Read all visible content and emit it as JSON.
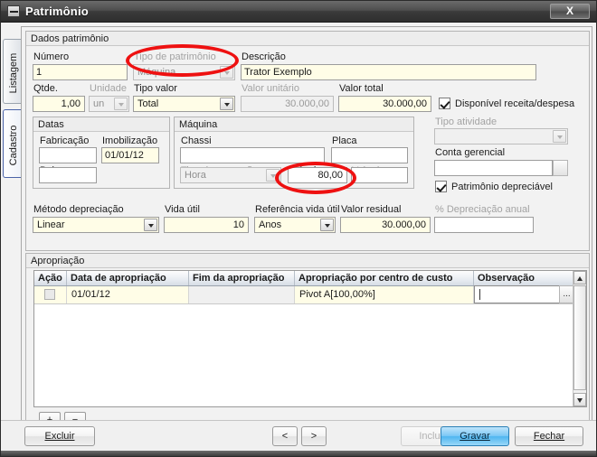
{
  "window": {
    "title": "Patrimônio",
    "close_label": "X",
    "icon": "minimize-box-icon"
  },
  "sidebar": {
    "tabs": [
      {
        "label": "Listagem",
        "selected": false
      },
      {
        "label": "Cadastro",
        "selected": true
      }
    ]
  },
  "groups": {
    "dados": "Dados patrimônio",
    "datas": "Datas",
    "maquina": "Máquina",
    "apropriacao": "Apropriação"
  },
  "form": {
    "numero": {
      "label": "Número",
      "value": "1"
    },
    "tipo_patrimonio": {
      "label": "Tipo de patrimônio",
      "value": "Máquina"
    },
    "descricao": {
      "label": "Descrição",
      "value": "Trator Exemplo"
    },
    "qtde": {
      "label": "Qtde.",
      "value": "1,00"
    },
    "unidade": {
      "label": "Unidade",
      "value": "un"
    },
    "tipo_valor": {
      "label": "Tipo valor",
      "value": "Total"
    },
    "valor_unitario": {
      "label": "Valor unitário",
      "value": "30.000,00"
    },
    "valor_total": {
      "label": "Valor total",
      "value": "30.000,00"
    },
    "disponivel_receita": {
      "label": "Disponível receita/despesa",
      "checked": true
    },
    "tipo_atividade": {
      "label": "Tipo atividade",
      "value": ""
    },
    "conta_gerencial": {
      "label": "Conta gerencial",
      "value": ""
    },
    "patrimonio_depreciavel": {
      "label": "Patrimônio depreciável",
      "checked": true
    },
    "fabricacao": {
      "label": "Fabricação",
      "value": ""
    },
    "imobilizacao": {
      "label": "Imobilização",
      "value": "01/01/12"
    },
    "baixa": {
      "label": "Baixa",
      "value": ""
    },
    "chassi": {
      "label": "Chassi",
      "value": ""
    },
    "placa": {
      "label": "Placa",
      "value": ""
    },
    "tipo_apuracao": {
      "label": "Tipo de apuração",
      "value": "Hora"
    },
    "valor_hora": {
      "label": "Valor hora",
      "value": "80,00"
    },
    "valor_km": {
      "label": "Valor km",
      "value": ""
    },
    "metodo_depreciacao": {
      "label": "Método depreciação",
      "value": "Linear"
    },
    "vida_util": {
      "label": "Vida útil",
      "value": "10"
    },
    "referencia_vida_util": {
      "label": "Referência vida útil",
      "value": "Anos"
    },
    "valor_residual": {
      "label": "Valor residual",
      "value": "30.000,00"
    },
    "perc_depreciacao_anual": {
      "label": "% Depreciação anual",
      "value": ""
    }
  },
  "grid": {
    "columns": [
      "Ação",
      "Data de apropriação",
      "Fim da apropriação",
      "Apropriação por centro de custo",
      "Observação"
    ],
    "rows": [
      {
        "acao": "",
        "data_apropriacao": "01/01/12",
        "fim_apropriacao": "",
        "centro_custo": "Pivot  A[100,00%]",
        "observacao": ""
      }
    ],
    "row_ellipsis_label": "...",
    "add_label": "+",
    "remove_label": "−"
  },
  "footer": {
    "excluir": "Excluir",
    "prev": "<",
    "next": ">",
    "incluir": "Incluir",
    "gravar": "Gravar",
    "fechar": "Fechar"
  },
  "highlights": [
    {
      "name": "tipo-patrimonio-highlight",
      "color": "#ee1111"
    },
    {
      "name": "valor-hora-highlight",
      "color": "#ee1111"
    }
  ]
}
